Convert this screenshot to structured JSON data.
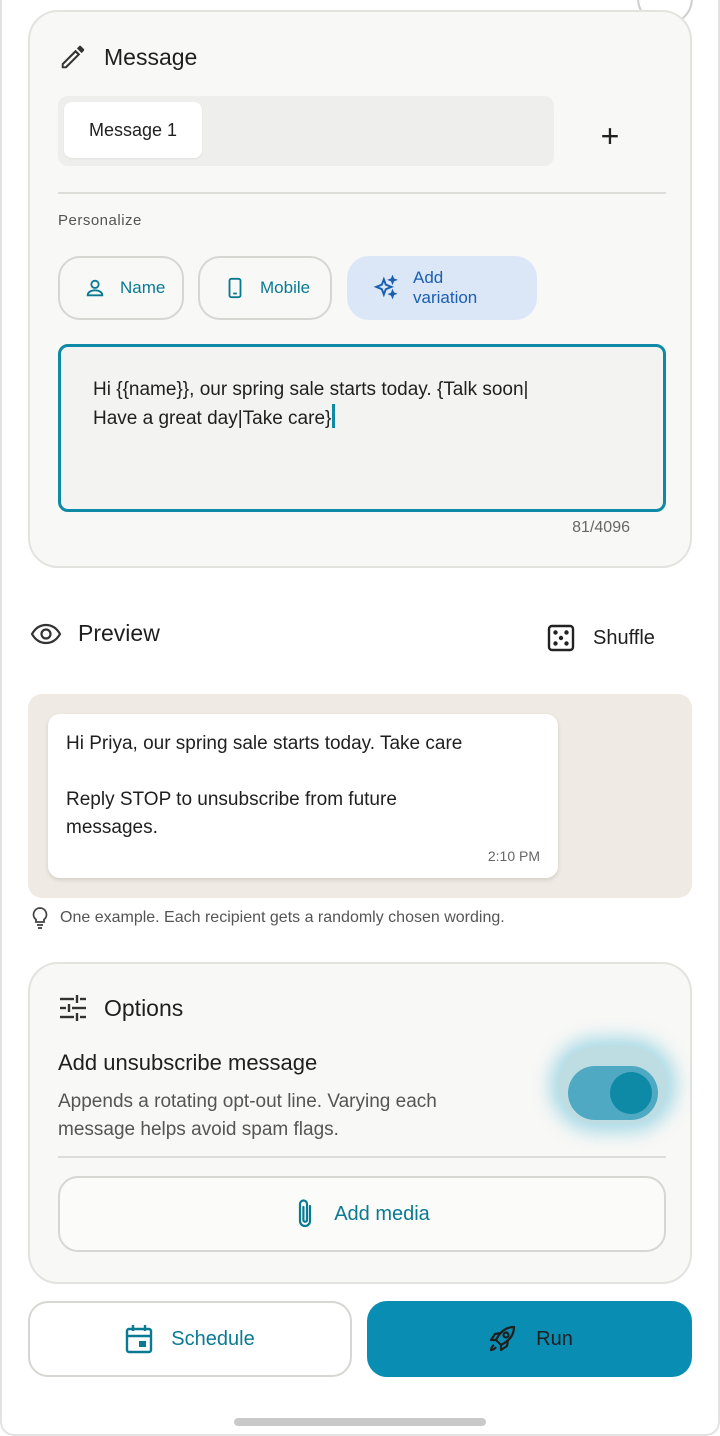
{
  "message_card": {
    "title": "Message",
    "tabs": [
      {
        "label": "Message 1",
        "active": true
      }
    ],
    "add_tab_label": "+",
    "personalize_label": "Personalize",
    "chips": {
      "name": "Name",
      "mobile": "Mobile",
      "add_variation": "Add variation"
    },
    "text_line1": "Hi {{name}}, our spring sale starts today. {Talk soon|",
    "text_line2": "Have a great day|Take care}",
    "counter": "81/4096"
  },
  "preview": {
    "title": "Preview",
    "shuffle_label": "Shuffle",
    "bubble_line1": "Hi Priya, our spring sale starts today. Take care",
    "bubble_line2": "Reply STOP to unsubscribe from future messages.",
    "time": "2:10 PM",
    "hint": "One example. Each recipient gets a randomly chosen wording."
  },
  "options": {
    "title": "Options",
    "unsubscribe_title": "Add unsubscribe message",
    "unsubscribe_desc": "Appends a rotating opt-out line. Varying each message helps avoid spam flags.",
    "unsubscribe_enabled": true,
    "add_media_label": "Add media"
  },
  "actions": {
    "schedule_label": "Schedule",
    "run_label": "Run"
  },
  "colors": {
    "accent": "#0a8db3",
    "accent_text": "#0a7a93",
    "variation_chip_bg": "#dbe6f7"
  }
}
